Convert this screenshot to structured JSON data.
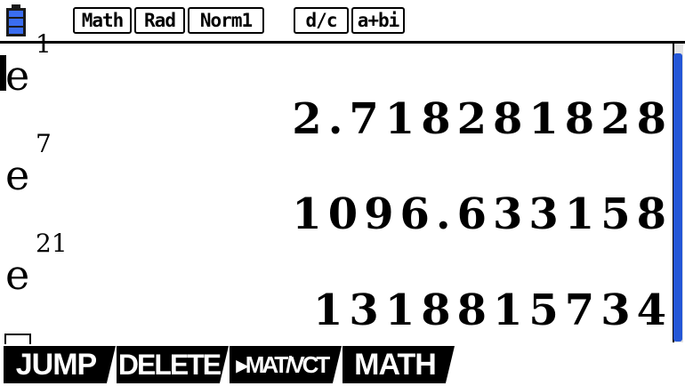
{
  "status_bar": {
    "battery_icon": "battery-icon",
    "mode_badges": [
      "Math",
      "Rad",
      "Norm1",
      "d/c",
      "a+bi"
    ]
  },
  "history": [
    {
      "base": "e",
      "exponent": "1",
      "result": "2.718281828"
    },
    {
      "base": "e",
      "exponent": "7",
      "result": "1096.633158"
    },
    {
      "base": "e",
      "exponent": "21",
      "result": "1318815734"
    }
  ],
  "function_keys": [
    "JUMP",
    "DELETE",
    "▸MAT/VCT",
    "MATH"
  ],
  "colors": {
    "battery": "#3a6df0",
    "scrollbar": "#2456d6",
    "fkey_bg": "#000000",
    "fkey_text": "#ffffff"
  }
}
